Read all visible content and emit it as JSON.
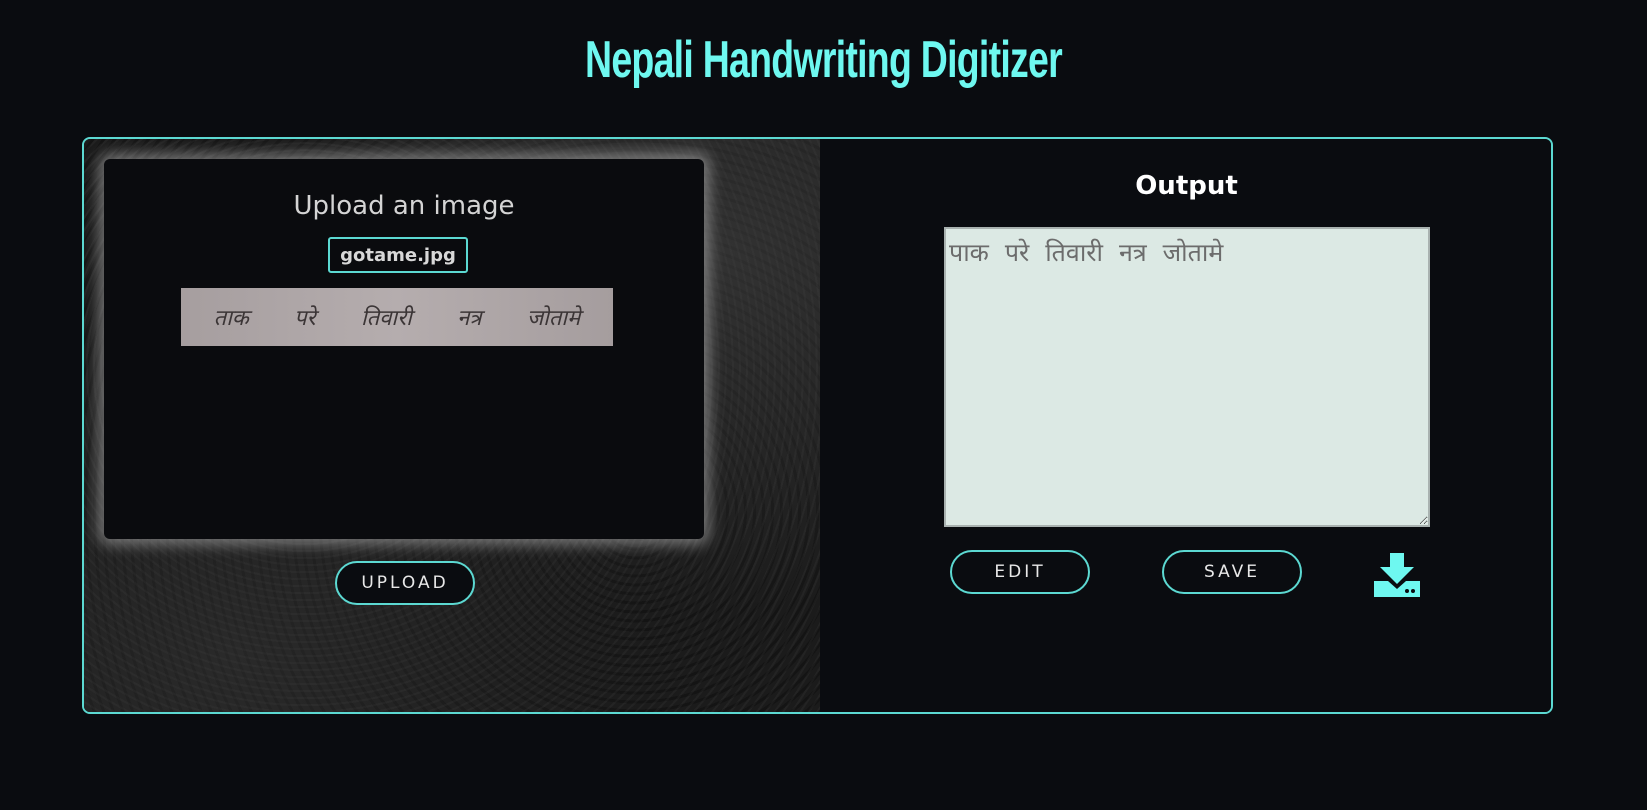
{
  "header": {
    "title": "Nepali Handwriting Digitizer"
  },
  "upload_panel": {
    "heading": "Upload an image",
    "file_name": "gotame.jpg",
    "preview_words": [
      "ताक",
      "परे",
      "तिवारी",
      "नत्र",
      "जोतामे"
    ],
    "upload_label": "UPLOAD"
  },
  "output_panel": {
    "heading": "Output",
    "text": "पाक परे तिवारी नत्र जोतामे",
    "edit_label": "EDIT",
    "save_label": "SAVE",
    "download_icon": "download-icon"
  },
  "colors": {
    "accent": "#5cd9d2",
    "title": "#6ef8f0",
    "background": "#0a0c10",
    "textarea_bg": "#dce9e4"
  }
}
